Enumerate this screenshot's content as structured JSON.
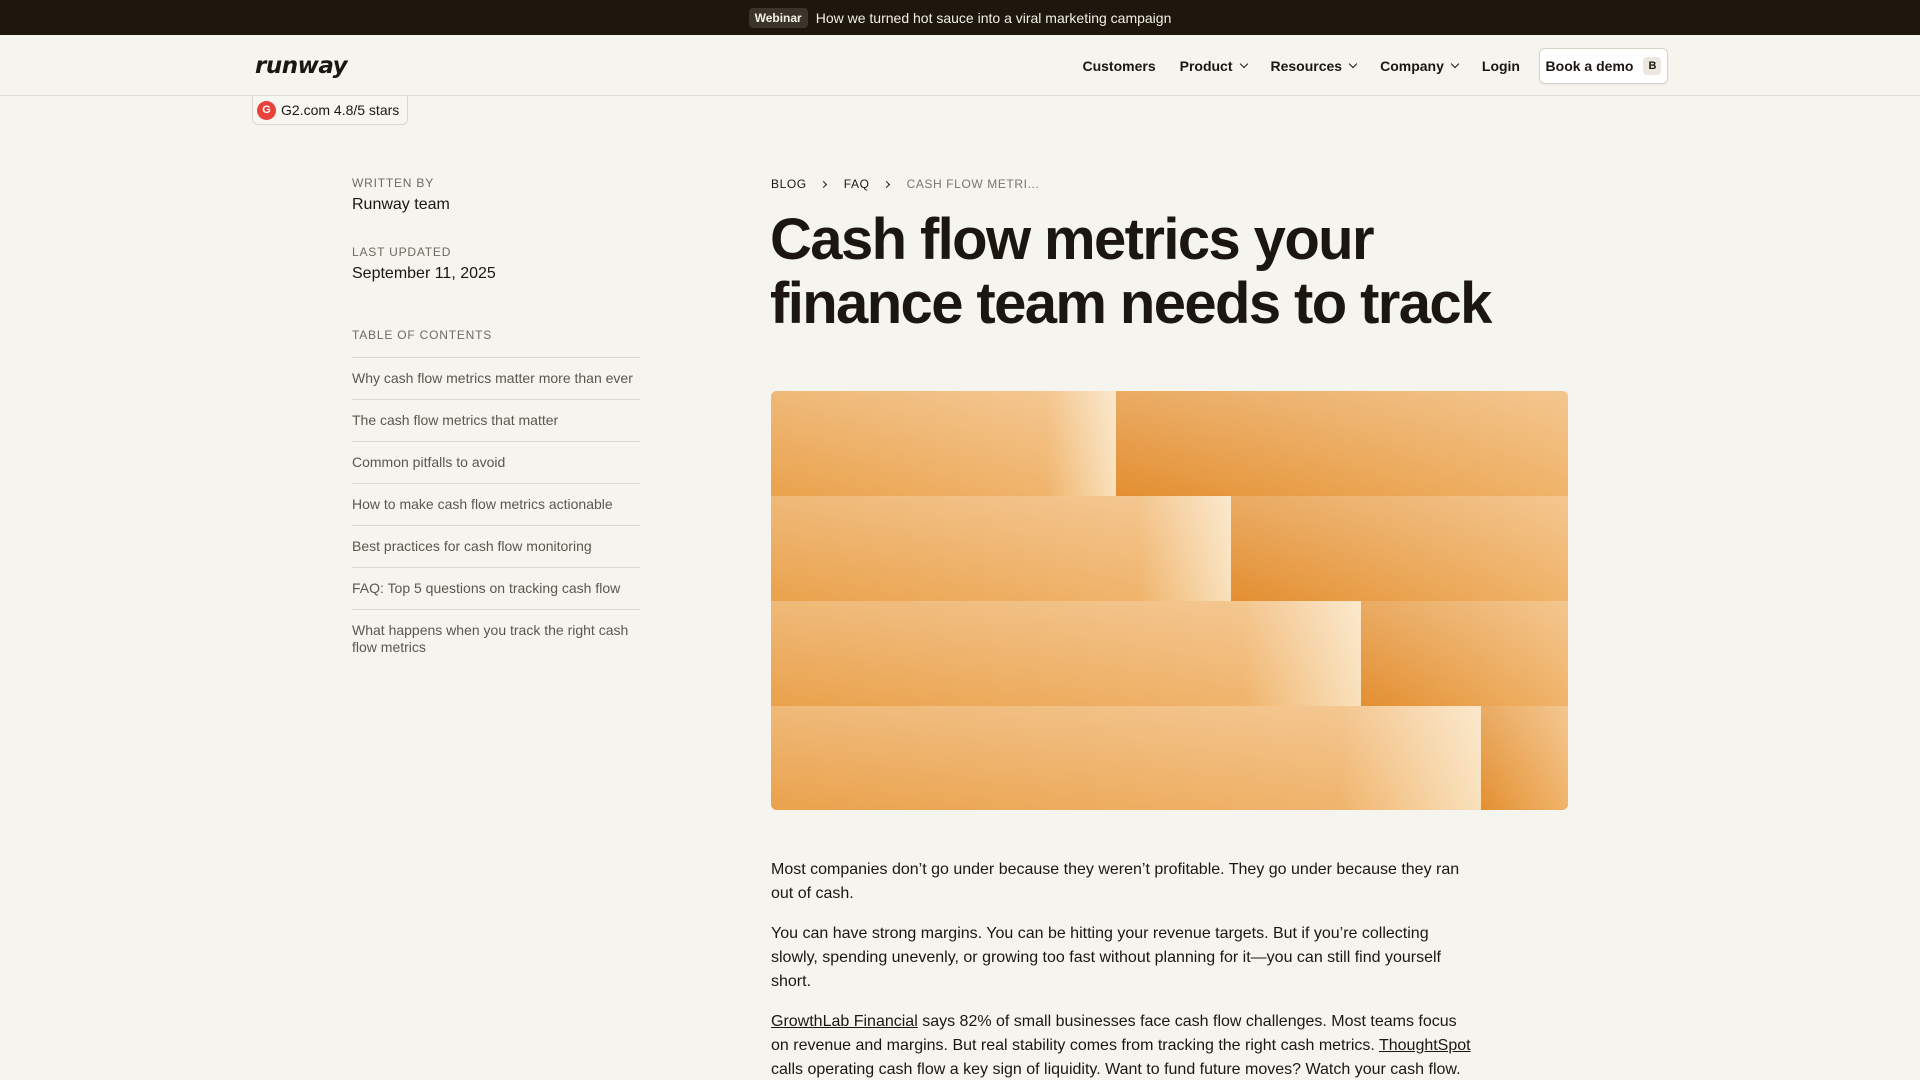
{
  "announcement": {
    "badge": "Webinar",
    "message": "How we turned hot sauce into a viral marketing campaign"
  },
  "nav": {
    "logo": "runway",
    "links": [
      "Customers",
      "Product",
      "Resources",
      "Company",
      "Login"
    ],
    "cta_label": "Book a demo",
    "cta_shortcut": "B"
  },
  "badge": {
    "icon": "g2-logo-icon",
    "text": "G2.com 4.8/5 stars"
  },
  "meta": {
    "written_by_label": "WRITTEN BY",
    "author": "Runway team",
    "updated_label": "LAST UPDATED",
    "updated_date": "September 11, 2025"
  },
  "toc": {
    "title": "TABLE OF CONTENTS",
    "items": [
      "Why cash flow metrics matter more than ever",
      "The cash flow metrics that matter",
      "Common pitfalls to avoid",
      "How to make cash flow metrics actionable",
      "Best practices for cash flow monitoring",
      "FAQ: Top 5 questions on tracking cash flow",
      "What happens when you track the right cash flow metrics"
    ]
  },
  "breadcrumb": [
    "BLOG",
    "FAQ",
    "CASH FLOW METRI..."
  ],
  "article": {
    "title": "Cash flow metrics your finance team needs to track",
    "p1": "Most companies don’t go under because they weren’t profitable. They go under because they ran out of cash.",
    "p2": "You can have strong margins. You can be hitting your revenue targets. But if you’re collecting slowly, spending unevenly, or growing too fast without planning for it—you can still find yourself short.",
    "p3_link1": "GrowthLab Financial",
    "p3_a": " says 82% of small businesses face cash flow challenges. Most teams focus on revenue and margins. But real stability comes from tracking the right cash metrics. ",
    "p3_link2": "ThoughtSpot",
    "p3_b": " calls operating cash flow a key sign of liquidity. Want to fund future moves? Watch your cash flow."
  },
  "colors": {
    "background": "#f6f4ef",
    "announcement_bg": "#1e170e",
    "hero_orange": "#e79a3e",
    "g2_red": "#e8433a"
  }
}
